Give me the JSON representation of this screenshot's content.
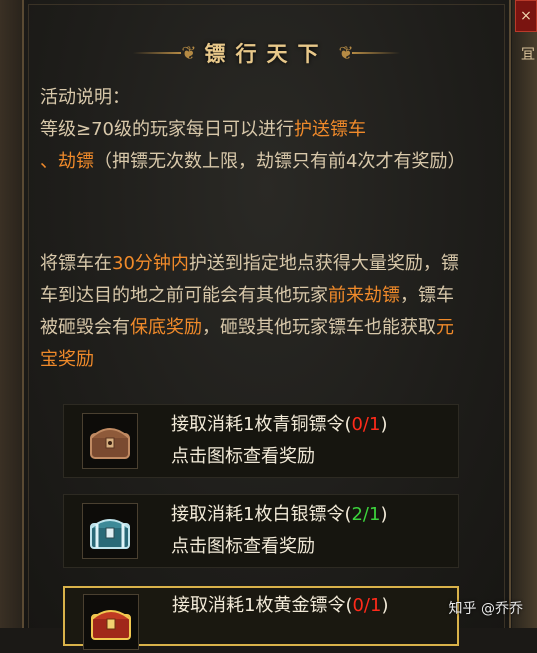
{
  "window": {
    "title": "镖行天下",
    "close_icon": "×",
    "right_edge_glyph": "冝"
  },
  "description": {
    "label": "活动说明：",
    "para1": {
      "text_a": "等级≥70级的玩家每日可以进行",
      "hl_a": "护送镖车",
      "sep": "、",
      "hl_b": "劫镖",
      "text_b": "（押镖无次数上限，劫镖只有前4次才有奖励）"
    },
    "para2": {
      "text_a": "将镖车在",
      "hl_a": "30分钟内",
      "text_b": "护送到指定地点获得大量奖励，镖车到达目的地之前可能会有其他玩家",
      "hl_b": "前来劫镖",
      "text_c": "，镖车被砸毁会有",
      "hl_c": "保底奖励",
      "text_d": "，砸毁其他玩家镖车也能获取",
      "hl_d": "元宝奖励"
    }
  },
  "tokens": [
    {
      "line1": "接取消耗1枚青铜镖令(",
      "count": "0/1",
      "close": ")",
      "line2": "点击图标查看奖励",
      "icon": "bronze-chest-icon"
    },
    {
      "line1": "接取消耗1枚白银镖令(",
      "count": "2/1",
      "close": ")",
      "line2": "点击图标查看奖励",
      "icon": "silver-chest-icon"
    },
    {
      "line1": "接取消耗1枚黄金镖令(",
      "count": "0/1",
      "close": ")",
      "line2": "",
      "icon": "gold-chest-icon"
    }
  ],
  "colors": {
    "highlight": "#f08a2a",
    "count_short": "#ff2a1a",
    "count_ok": "#3cd23c",
    "frame_gold": "#d9b24a"
  },
  "watermark": "知乎 @乔乔"
}
